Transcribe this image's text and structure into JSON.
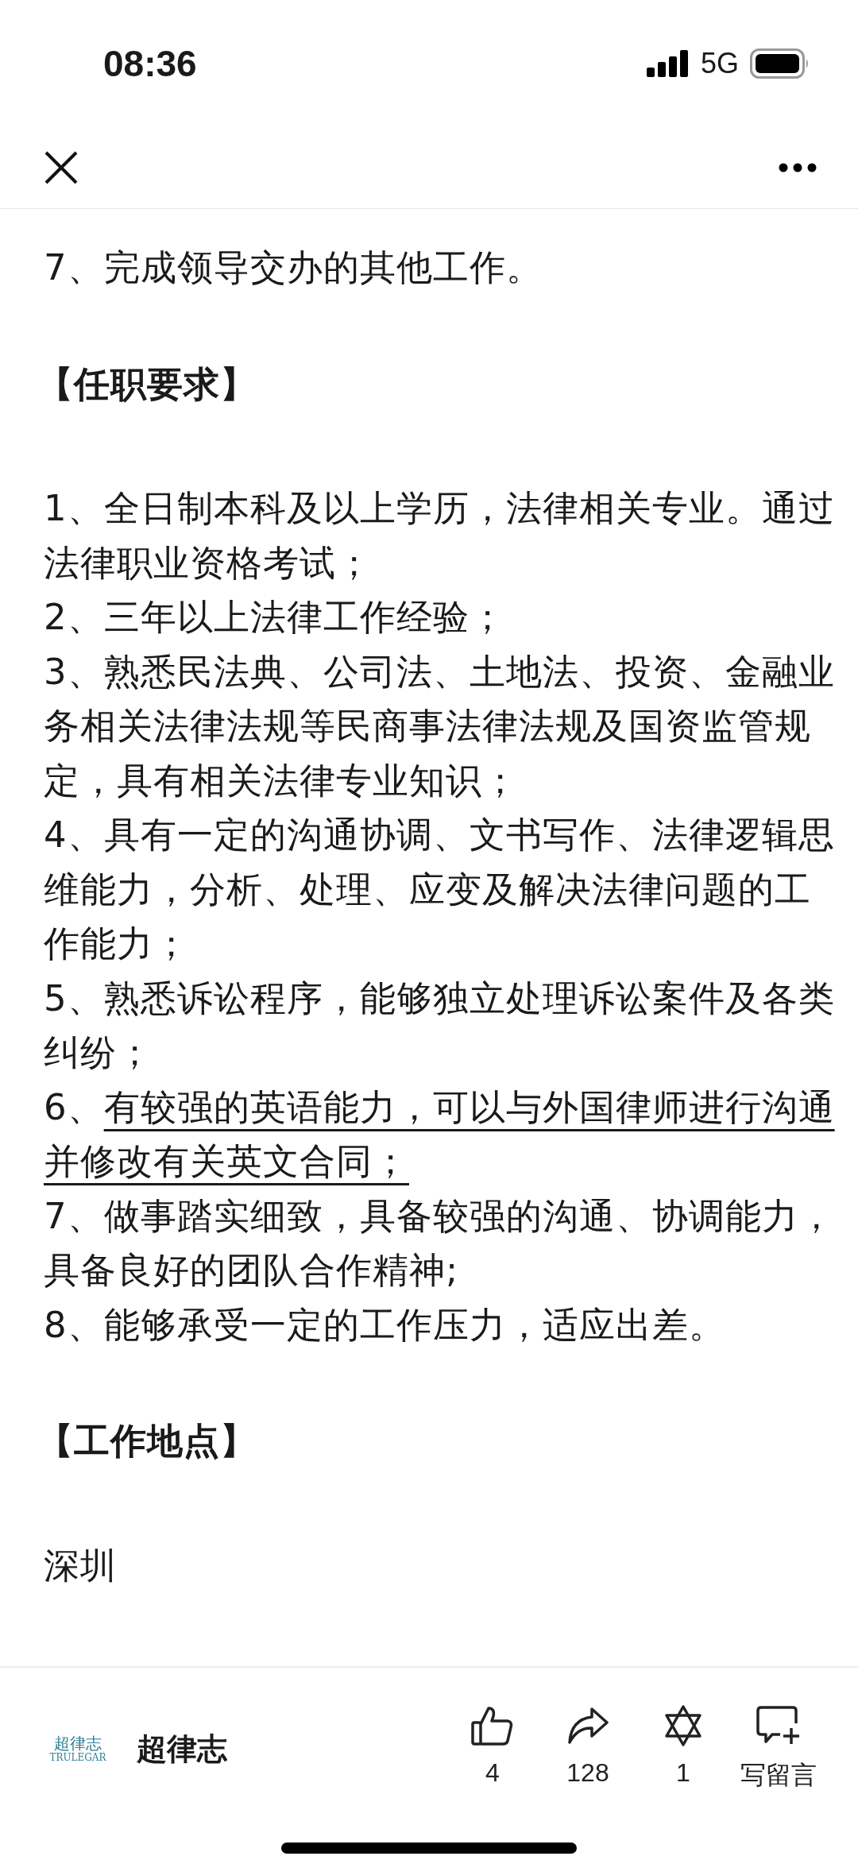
{
  "status_bar": {
    "time": "08:36",
    "network": "5G"
  },
  "article": {
    "blocks": [
      {
        "kind": "item",
        "number": "7、",
        "text": "完成领导交办的其他工作。",
        "underlined": false
      },
      {
        "kind": "heading",
        "text": "【任职要求】"
      },
      {
        "kind": "item",
        "number": "1、",
        "text": "全日制本科及以上学历，法律相关专业。通过法律职业资格考试；",
        "underlined": false
      },
      {
        "kind": "item",
        "number": "2、",
        "text": "三年以上法律工作经验；",
        "underlined": false
      },
      {
        "kind": "item",
        "number": "3、",
        "text": "熟悉民法典、公司法、土地法、投资、金融业务相关法律法规等民商事法律法规及国资监管规定，具有相关法律专业知识；",
        "underlined": false
      },
      {
        "kind": "item",
        "number": "4、",
        "text": "具有一定的沟通协调、文书写作、法律逻辑思维能力，分析、处理、应变及解决法律问题的工作能力；",
        "underlined": false
      },
      {
        "kind": "item",
        "number": "5、",
        "text": "熟悉诉讼程序，能够独立处理诉讼案件及各类纠纷；",
        "underlined": false
      },
      {
        "kind": "item",
        "number": "6、",
        "text": "有较强的英语能力，可以与外国律师进行沟通并修改有关英文合同；",
        "underlined": true
      },
      {
        "kind": "item",
        "number": "7、",
        "text": "做事踏实细致，具备较强的沟通、协调能力，具备良好的团队合作精神;",
        "underlined": false
      },
      {
        "kind": "item",
        "number": "8、",
        "text": "能够承受一定的工作压力，适应出差。",
        "underlined": false
      },
      {
        "kind": "heading",
        "text": "【工作地点】"
      },
      {
        "kind": "paragraph",
        "text": "深圳"
      }
    ]
  },
  "bottom_bar": {
    "logo": {
      "title": "超律志",
      "subtitle": "TRULEGAR"
    },
    "account_name": "超律志",
    "actions": [
      {
        "kind": "like",
        "label": "4"
      },
      {
        "kind": "share",
        "label": "128"
      },
      {
        "kind": "wow",
        "label": "1"
      },
      {
        "kind": "comment",
        "label": "写留言"
      }
    ]
  }
}
